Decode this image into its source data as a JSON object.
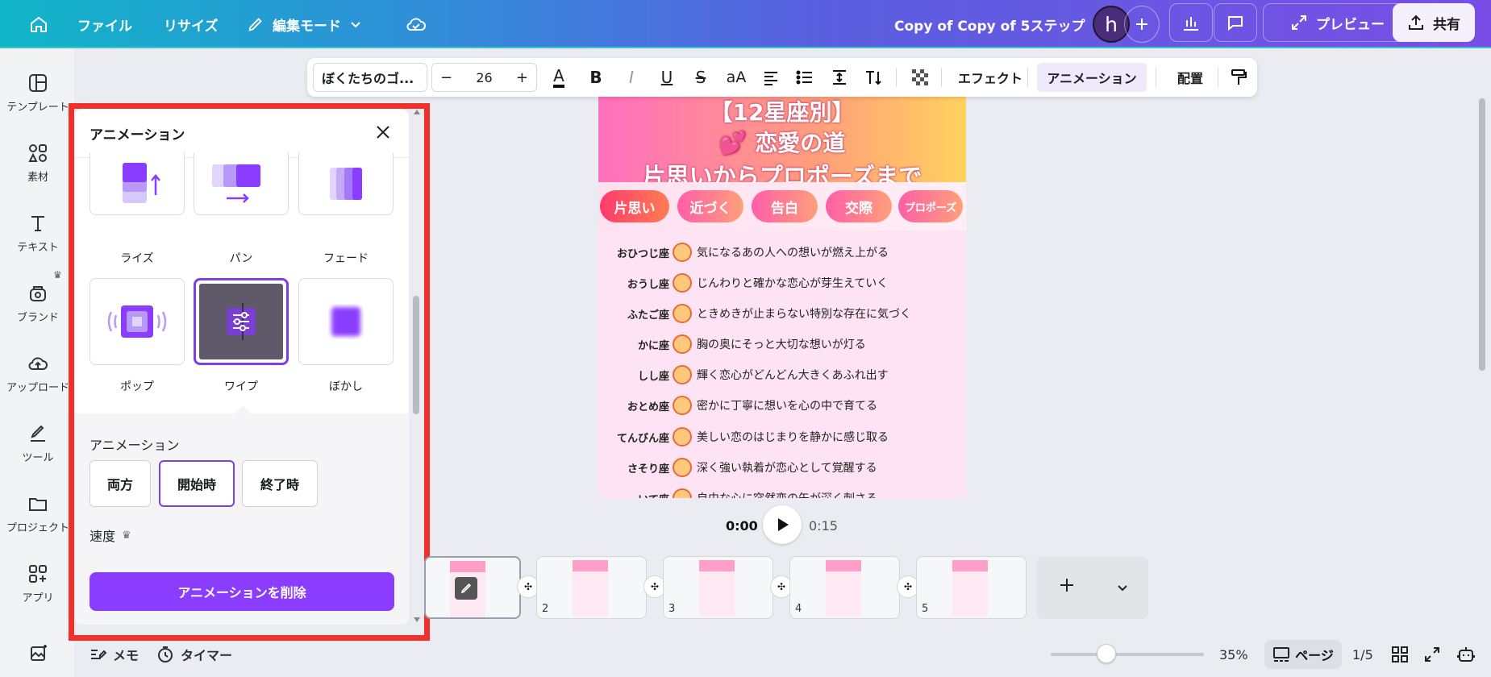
{
  "topbar": {
    "menu_file": "ファイル",
    "menu_resize": "リサイズ",
    "menu_edit_mode": "編集モード",
    "doc_title": "Copy of Copy of 5ステップ",
    "avatar_letter": "h",
    "preview_label": "プレビュー",
    "share_label": "共有"
  },
  "sidebar": {
    "items": [
      {
        "label": "テンプレート",
        "icon": "template-icon"
      },
      {
        "label": "素材",
        "icon": "elements-icon"
      },
      {
        "label": "テキスト",
        "icon": "text-icon"
      },
      {
        "label": "ブランド",
        "icon": "brand-icon"
      },
      {
        "label": "アップロード",
        "icon": "upload-icon"
      },
      {
        "label": "ツール",
        "icon": "draw-icon"
      },
      {
        "label": "プロジェクト",
        "icon": "folder-icon"
      },
      {
        "label": "アプリ",
        "icon": "apps-icon"
      }
    ]
  },
  "toolbar": {
    "font_name": "ぼくたちのゴ...",
    "font_size": "26",
    "decrease": "−",
    "increase": "+",
    "effects": "エフェクト",
    "animation": "アニメーション",
    "position": "配置"
  },
  "panel": {
    "title": "アニメーション",
    "tiles": [
      {
        "label": "ライズ",
        "icon": "rise-icon"
      },
      {
        "label": "パン",
        "icon": "pan-icon"
      },
      {
        "label": "フェード",
        "icon": "fade-icon"
      },
      {
        "label": "ポップ",
        "icon": "pop-icon"
      },
      {
        "label": "ワイプ",
        "icon": "wipe-icon",
        "selected": true
      },
      {
        "label": "ぼかし",
        "icon": "blur-icon"
      }
    ],
    "section_label": "アニメーション",
    "directions": [
      "両方",
      "開始時",
      "終了時"
    ],
    "selected_direction": "開始時",
    "speed_label": "速度",
    "delete_label": "アニメーションを削除"
  },
  "design": {
    "headline_1": "【12星座別】",
    "headline_2": "恋愛の道",
    "headline_3": "片思いからプロポーズまで",
    "steps": [
      "片思い",
      "近づく",
      "告白",
      "交際",
      "プロポーズ"
    ],
    "rows": [
      {
        "sign": "おひつじ座",
        "text": "気になるあの人への想いが燃え上がる"
      },
      {
        "sign": "おうし座",
        "text": "じんわりと確かな恋心が芽生えていく"
      },
      {
        "sign": "ふたご座",
        "text": "ときめきが止まらない特別な存在に気づく"
      },
      {
        "sign": "かに座",
        "text": "胸の奥にそっと大切な想いが灯る"
      },
      {
        "sign": "しし座",
        "text": "輝く恋心がどんどん大きくあふれ出す"
      },
      {
        "sign": "おとめ座",
        "text": "密かに丁寧に想いを心の中で育てる"
      },
      {
        "sign": "てんびん座",
        "text": "美しい恋のはじまりを静かに感じ取る"
      },
      {
        "sign": "さそり座",
        "text": "深く強い執着が恋心として覚醒する"
      },
      {
        "sign": "いて座",
        "text": "自由な心に突然恋の矢が深く刺さる"
      }
    ]
  },
  "playback": {
    "current": "0:00",
    "total": "0:15"
  },
  "pages": [
    "2",
    "3",
    "4",
    "5"
  ],
  "bottom": {
    "notes": "メモ",
    "timer": "タイマー",
    "zoom": "35%",
    "zoom_fraction": 0.35,
    "page_view": "ページ",
    "page_count": "1/5"
  },
  "colors": {
    "accent": "#8b3dff",
    "highlight_frame": "#f1302b"
  }
}
